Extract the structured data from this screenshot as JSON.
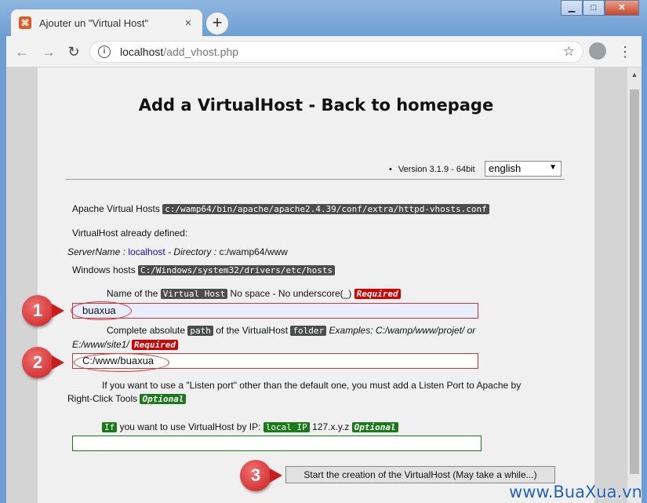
{
  "browser": {
    "tab_title": "Ajouter un \"Virtual Host\"",
    "tab_close": "×",
    "new_tab": "+",
    "url_host": "localhost",
    "url_path": "/add_vhost.php",
    "info": "i",
    "icons": {
      "back": "arrow-left-icon",
      "forward": "arrow-right-icon",
      "reload": "reload-icon",
      "star": "star-icon",
      "menu": "kebab-menu-icon"
    }
  },
  "page": {
    "heading": "Add a VirtualHost - Back to homepage",
    "version": "Version 3.1.9 - 64bit",
    "language": "english",
    "apache_label": "Apache Virtual Hosts",
    "apache_path": "c:/wamp64/bin/apache/apache2.4.39/conf/extra/httpd-vhosts.conf",
    "already_defined": "VirtualHost already defined:",
    "servername_label": "ServerName :",
    "servername_value": "localhost",
    "directory_label": "- Directory :",
    "directory_value": "c:/wamp64/www",
    "hosts_label": "Windows hosts",
    "hosts_path": "C:/Windows/system32/drivers/etc/hosts",
    "name_prefix": "Name of the",
    "name_code": "Virtual Host",
    "name_suffix": "No space - No underscore(_)",
    "required": "Required",
    "name_value": "buaxua",
    "path_prefix": "Complete absolute",
    "path_code": "path",
    "path_middle": "of the VirtualHost",
    "path_code2": "folder",
    "path_examples": "Examples: C:/wamp/www/projet/ or",
    "path_examples2": "E:/www/site1/",
    "path_value": "C:/www/buaxua",
    "port_line1": "If you want to use a \"Listen port\" other than the default one, you must add a Listen Port to Apache by",
    "port_line2": "Right-Click Tools",
    "optional": "Optional",
    "ip_code": "If",
    "ip_text": "you want to use VirtualHost by IP:",
    "ip_code2": "local IP",
    "ip_example": "127.x.y.z",
    "ip_value": "",
    "submit": "Start the creation of the VirtualHost (May take a while...)"
  },
  "annotations": {
    "step1": "1",
    "step2": "2",
    "step3": "3"
  },
  "watermark": "www.BuaXua.vn"
}
